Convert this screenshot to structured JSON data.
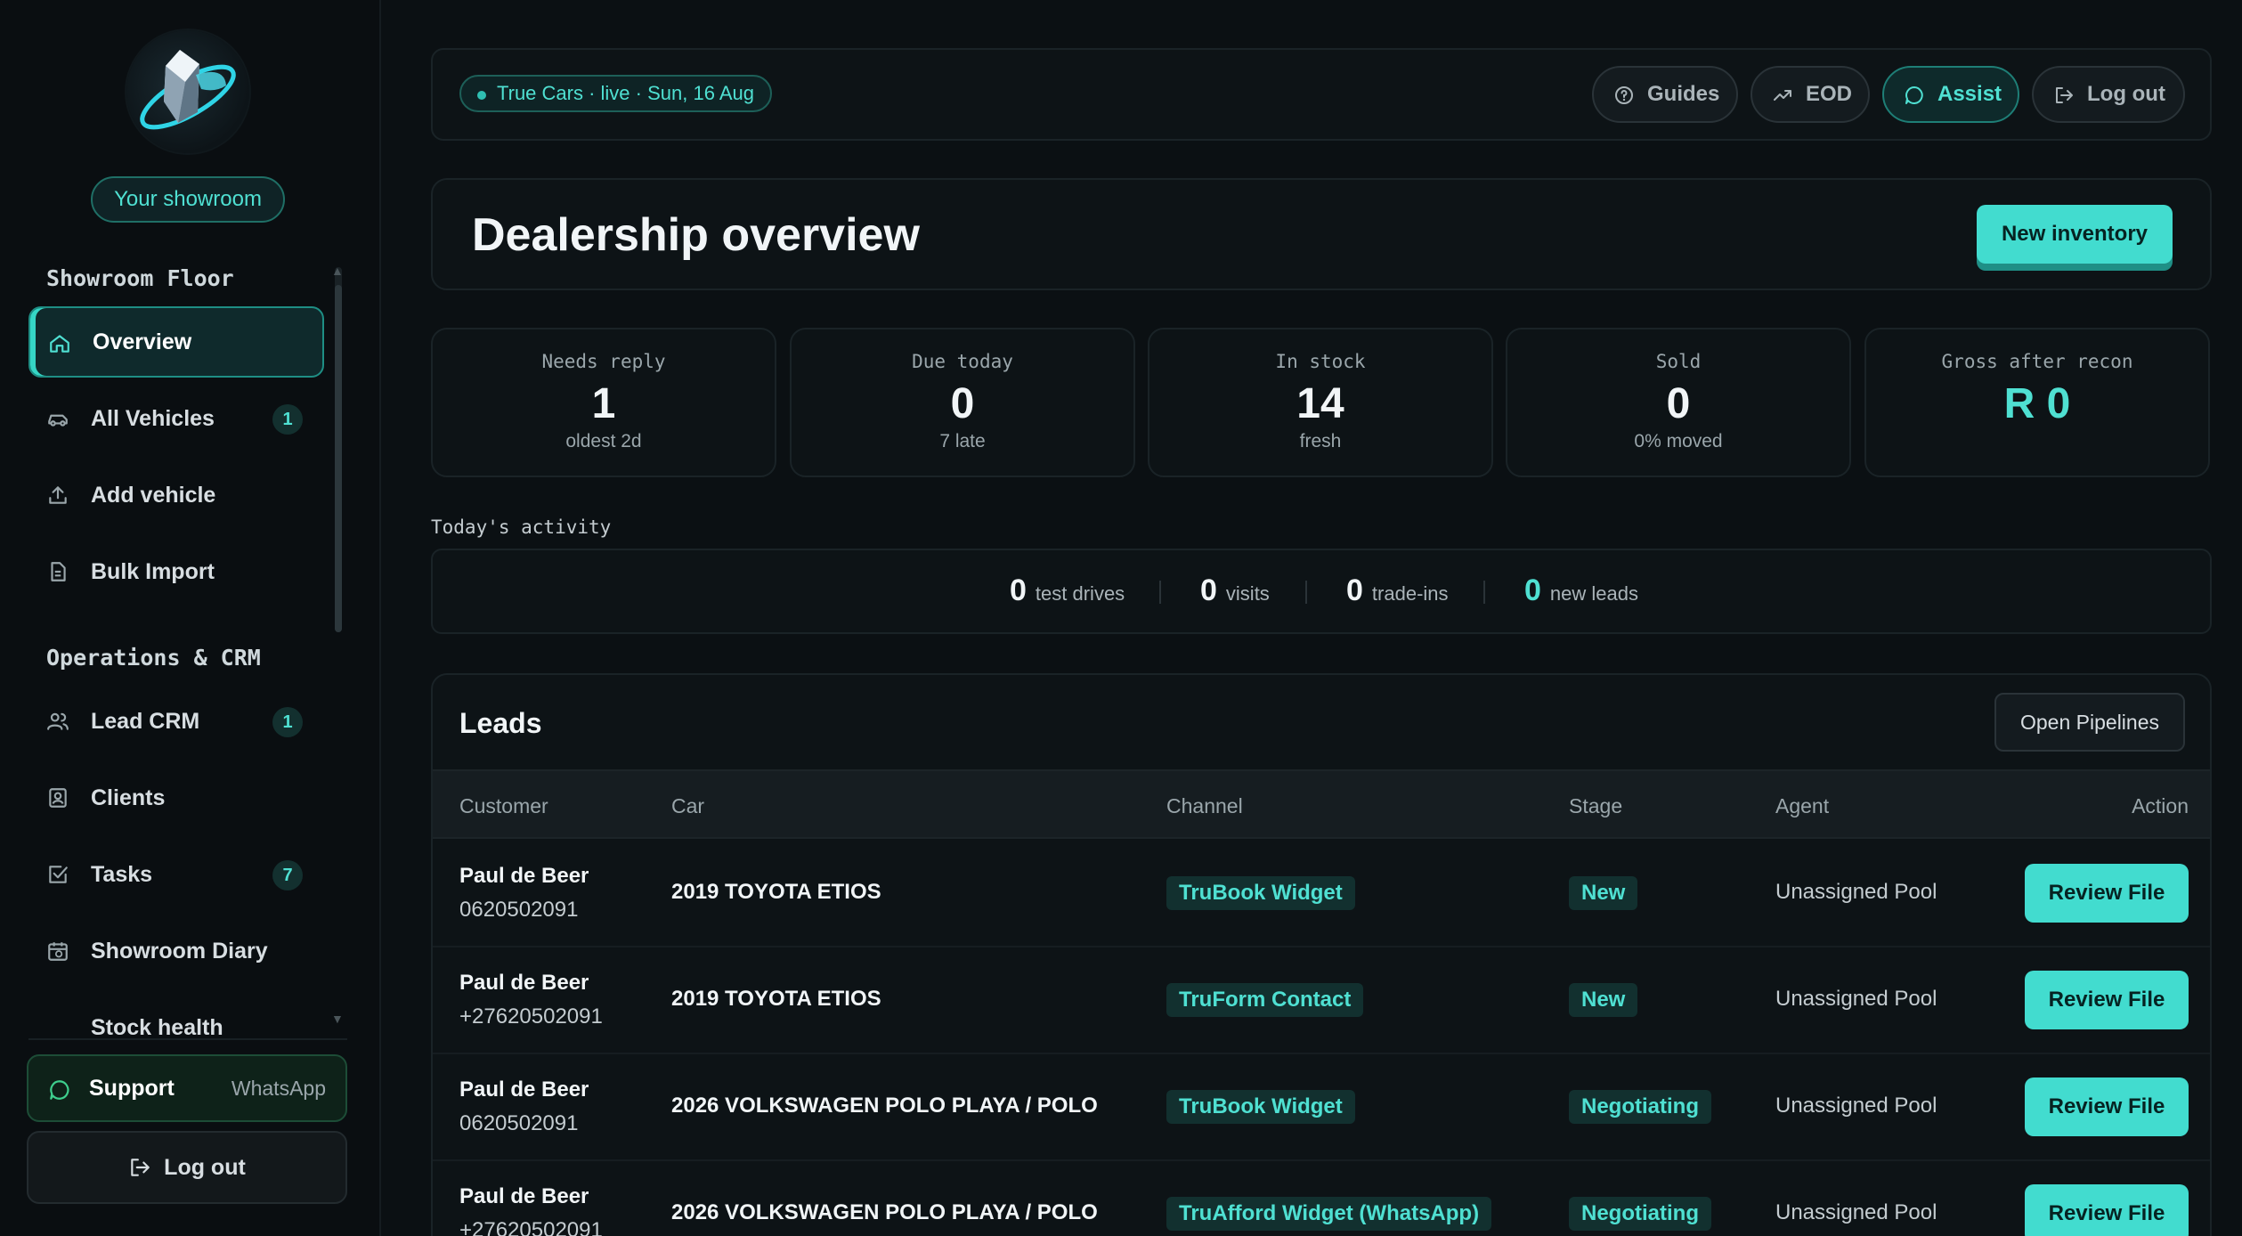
{
  "sidebar": {
    "showroom_label": "Your showroom",
    "section_showroom": "Showroom Floor",
    "section_ops": "Operations & CRM",
    "items": [
      {
        "label": "Overview",
        "badge": ""
      },
      {
        "label": "All Vehicles",
        "badge": "1"
      },
      {
        "label": "Add vehicle",
        "badge": ""
      },
      {
        "label": "Bulk Import",
        "badge": ""
      },
      {
        "label": "Lead CRM",
        "badge": "1"
      },
      {
        "label": "Clients",
        "badge": ""
      },
      {
        "label": "Tasks",
        "badge": "7"
      },
      {
        "label": "Showroom Diary",
        "badge": ""
      },
      {
        "label": "Stock health",
        "badge": ""
      }
    ],
    "support_label": "Support",
    "support_sub": "WhatsApp",
    "logout_label": "Log out"
  },
  "topbar": {
    "status": "True Cars · live · Sun, 16 Aug",
    "guides": "Guides",
    "eod": "EOD",
    "assist": "Assist",
    "logout": "Log out"
  },
  "header": {
    "title": "Dealership overview",
    "new_inventory": "New inventory"
  },
  "stats": [
    {
      "label": "Needs reply",
      "value": "1",
      "sub": "oldest 2d"
    },
    {
      "label": "Due today",
      "value": "0",
      "sub": "7 late"
    },
    {
      "label": "In stock",
      "value": "14",
      "sub": "fresh"
    },
    {
      "label": "Sold",
      "value": "0",
      "sub": "0% moved"
    },
    {
      "label": "Gross after recon",
      "value": "R 0",
      "sub": ""
    }
  ],
  "activity": {
    "label": "Today's activity",
    "items": [
      {
        "num": "0",
        "text": "test drives"
      },
      {
        "num": "0",
        "text": "visits"
      },
      {
        "num": "0",
        "text": "trade-ins"
      },
      {
        "num": "0",
        "text": "new leads"
      }
    ]
  },
  "leads": {
    "title": "Leads",
    "open_pipelines": "Open Pipelines",
    "columns": [
      "Customer",
      "Car",
      "Channel",
      "Stage",
      "Agent",
      "Action"
    ],
    "rows": [
      {
        "name": "Paul de Beer",
        "phone": "0620502091",
        "car": "2019 TOYOTA ETIOS",
        "channel": "TruBook Widget",
        "stage": "New",
        "agent": "Unassigned Pool",
        "action": "Review File"
      },
      {
        "name": "Paul de Beer",
        "phone": "+27620502091",
        "car": "2019 TOYOTA ETIOS",
        "channel": "TruForm Contact",
        "stage": "New",
        "agent": "Unassigned Pool",
        "action": "Review File"
      },
      {
        "name": "Paul de Beer",
        "phone": "0620502091",
        "car": "2026 VOLKSWAGEN POLO PLAYA / POLO",
        "channel": "TruBook Widget",
        "stage": "Negotiating",
        "agent": "Unassigned Pool",
        "action": "Review File"
      },
      {
        "name": "Paul de Beer",
        "phone": "+27620502091",
        "car": "2026 VOLKSWAGEN POLO PLAYA / POLO",
        "channel": "TruAfford Widget (WhatsApp)",
        "stage": "Negotiating",
        "agent": "Unassigned Pool",
        "action": "Review File"
      }
    ]
  },
  "colors": {
    "accent": "#42dccf",
    "background": "#0b1013",
    "card": "#0d1316"
  }
}
